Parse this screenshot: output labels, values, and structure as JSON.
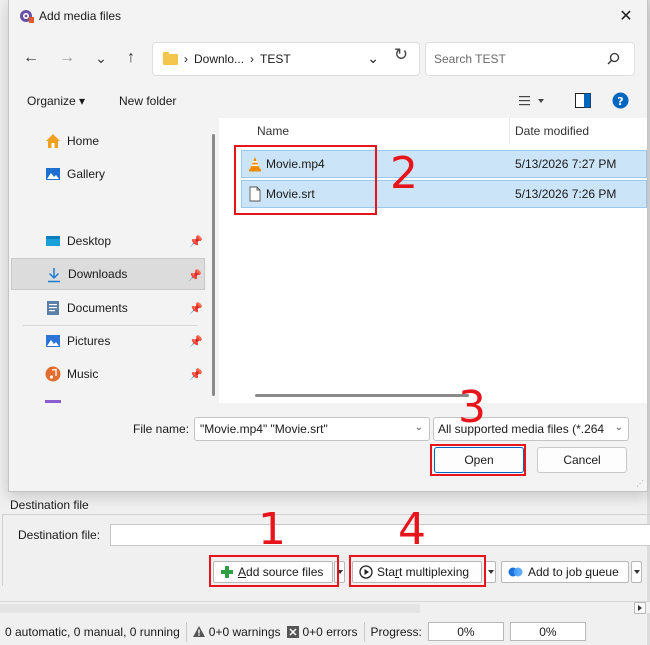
{
  "dialog": {
    "title": "Add media files",
    "close_glyph": "✕",
    "nav": {
      "back_glyph": "←",
      "forward_glyph": "→",
      "recent_glyph": "⌄",
      "up_glyph": "↑"
    },
    "address": {
      "sep1": "›",
      "crumb1": "Downlo...",
      "sep2": "›",
      "crumb2": "TEST",
      "dropdown_glyph": "⌄",
      "refresh_glyph": "↻"
    },
    "search": {
      "placeholder": "Search TEST"
    },
    "commands": {
      "organize": "Organize ▾",
      "new_folder": "New folder"
    },
    "sidebar": {
      "items": [
        {
          "label": "Home",
          "icon": "home-icon"
        },
        {
          "label": "Gallery",
          "icon": "gallery-icon"
        },
        {
          "label": "Desktop",
          "icon": "desktop-icon",
          "pinned": true
        },
        {
          "label": "Downloads",
          "icon": "download-icon",
          "pinned": true,
          "selected": true
        },
        {
          "label": "Documents",
          "icon": "documents-icon",
          "pinned": true
        },
        {
          "label": "Pictures",
          "icon": "pictures-icon",
          "pinned": true
        },
        {
          "label": "Music",
          "icon": "music-icon",
          "pinned": true
        }
      ]
    },
    "files": {
      "columns": {
        "name": "Name",
        "date": "Date modified"
      },
      "rows": [
        {
          "name": "Movie.mp4",
          "date": "5/13/2026 7:27 PM",
          "icon": "vlc-icon",
          "selected": true
        },
        {
          "name": "Movie.srt",
          "date": "5/13/2026 7:26 PM",
          "icon": "text-file-icon",
          "selected": true
        }
      ]
    },
    "filename": {
      "label": "File name:",
      "value": "\"Movie.mp4\" \"Movie.srt\"",
      "dropdown_glyph": "⌄"
    },
    "filter": {
      "value": "All supported media files (*.264",
      "dropdown_glyph": "⌄"
    },
    "buttons": {
      "open": "Open",
      "cancel": "Cancel"
    }
  },
  "app": {
    "destination": {
      "group_title": "Destination file",
      "label": "Destination file:"
    },
    "toolbar": {
      "add_source_prefix": "A",
      "add_source_rest": "dd source files",
      "start_mux_prefix": "Sta",
      "start_mux_underline": "r",
      "start_mux_rest": "t multiplexing",
      "add_job_prefix": "Add to job ",
      "add_job_underline": "q",
      "add_job_rest": "ueue"
    },
    "status": {
      "jobs": "0 automatic, 0 manual, 0 running",
      "warnings": "0+0 warnings",
      "errors": "0+0 errors",
      "progress_label": "Progress:",
      "progress_current": "0%",
      "progress_total": "0%"
    }
  },
  "annotations": [
    {
      "number": "1",
      "target": "add-source-files"
    },
    {
      "number": "2",
      "target": "selected-files"
    },
    {
      "number": "3",
      "target": "open-button"
    },
    {
      "number": "4",
      "target": "start-multiplexing"
    }
  ],
  "colors": {
    "annotation_red": "#e8141c",
    "selection_blue": "#cce4f7",
    "accent": "#0067c0"
  }
}
